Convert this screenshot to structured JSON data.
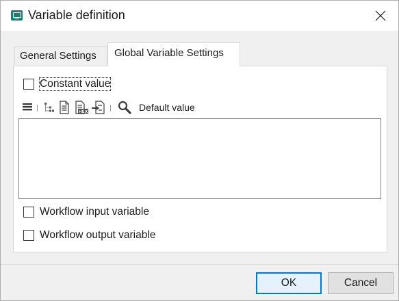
{
  "window": {
    "title": "Variable definition",
    "icons": {
      "app": "variable-app-icon",
      "close": "close-icon"
    }
  },
  "tabs": [
    {
      "label": "General Settings",
      "active": false
    },
    {
      "label": "Global Variable Settings",
      "active": true
    }
  ],
  "global": {
    "constant_value": {
      "label": "Constant value",
      "checked": false
    },
    "toolbar": {
      "icons": [
        "menu-icon",
        "tree-icon",
        "document-icon",
        "hex-document-icon",
        "import-document-icon",
        "search-icon"
      ],
      "default_value_label": "Default value"
    },
    "value_text": "",
    "workflow_input": {
      "label": "Workflow input variable",
      "checked": false
    },
    "workflow_output": {
      "label": "Workflow output variable",
      "checked": false
    }
  },
  "buttons": {
    "ok": "OK",
    "cancel": "Cancel"
  },
  "colors": {
    "accent": "#0078d7",
    "app_icon": "#1d7f73",
    "dialog_bg": "#f0f0f0"
  }
}
